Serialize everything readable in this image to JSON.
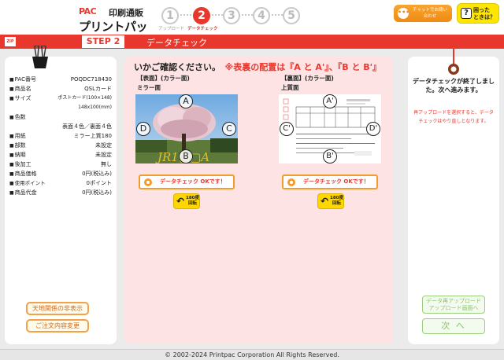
{
  "header": {
    "logo_prefix": "PAC",
    "logo_sub": "印刷通販",
    "logo_main": "プリントパック",
    "steps": [
      {
        "num": "1",
        "label": "アップロード"
      },
      {
        "num": "2",
        "label": "データチェック"
      },
      {
        "num": "3",
        "label": ""
      },
      {
        "num": "4",
        "label": ""
      },
      {
        "num": "5",
        "label": ""
      }
    ],
    "active_step": 2,
    "chat_label": "チャットでお問い合わせ",
    "help_label_1": "困った",
    "help_label_2": "ときは？",
    "help_icon": "?"
  },
  "bar": {
    "zip_label": "ZIP",
    "step_tag": "STEP 2",
    "title": "データチェック"
  },
  "order_info": [
    {
      "key": "PAC番号",
      "value": "POQDC718430"
    },
    {
      "key": "商品名",
      "value": "QSLカード"
    },
    {
      "key": "サイズ",
      "value": "ポストカード(100×148)"
    },
    {
      "key": "",
      "value": "148x100(mm)"
    },
    {
      "key": "色数",
      "value": ""
    },
    {
      "key": "",
      "value": "表面４色／裏面４色"
    },
    {
      "key": "用紙",
      "value": "ミラー上質180"
    },
    {
      "key": "部数",
      "value": "未設定"
    },
    {
      "key": "納期",
      "value": "未設定"
    },
    {
      "key": "後加工",
      "value": "無し"
    },
    {
      "key": "商品価格",
      "value": "0円(税込み)"
    },
    {
      "key": "使用ポイント",
      "value": "0ポイント"
    },
    {
      "key": "商品代金",
      "value": "0円(税込み)"
    }
  ],
  "left_buttons": {
    "tenchi": "天地関係の非表示",
    "order_change": "ご注文内容変更"
  },
  "center": {
    "notice_black": "いかご確認ください。",
    "notice_red": "※表裏の配置は『A と A'』、『B と B'』",
    "front": {
      "title": "【表面】(カラー面)",
      "sub": "ミラー面",
      "photo_text": "JR1▢▢A",
      "marks": [
        "A",
        "B",
        "C",
        "D"
      ]
    },
    "back": {
      "title": "【裏面】(カラー面)",
      "sub": "上質面",
      "marks": [
        "A'",
        "B'",
        "C'",
        "D'"
      ]
    },
    "ok_label": "データチェック OKです！",
    "rotate_label_1": "180度",
    "rotate_label_2": "回転"
  },
  "right": {
    "message": "データチェックが終了しました。次へ進みます。",
    "red_note": "再アップロードを選択すると、データチェックはやり直しとなります。",
    "reupload_1": "データ再アップロード",
    "reupload_2": "アップロード画面へ",
    "next_label": "次 へ"
  },
  "footer": {
    "copyright": "© 2002-2024 Printpac Corporation All Rights Reserved."
  },
  "colors": {
    "brand_red": "#e8382d",
    "accent_orange": "#f39c2c",
    "center_bg": "#fde3e3",
    "help_yellow": "#ffe600"
  }
}
